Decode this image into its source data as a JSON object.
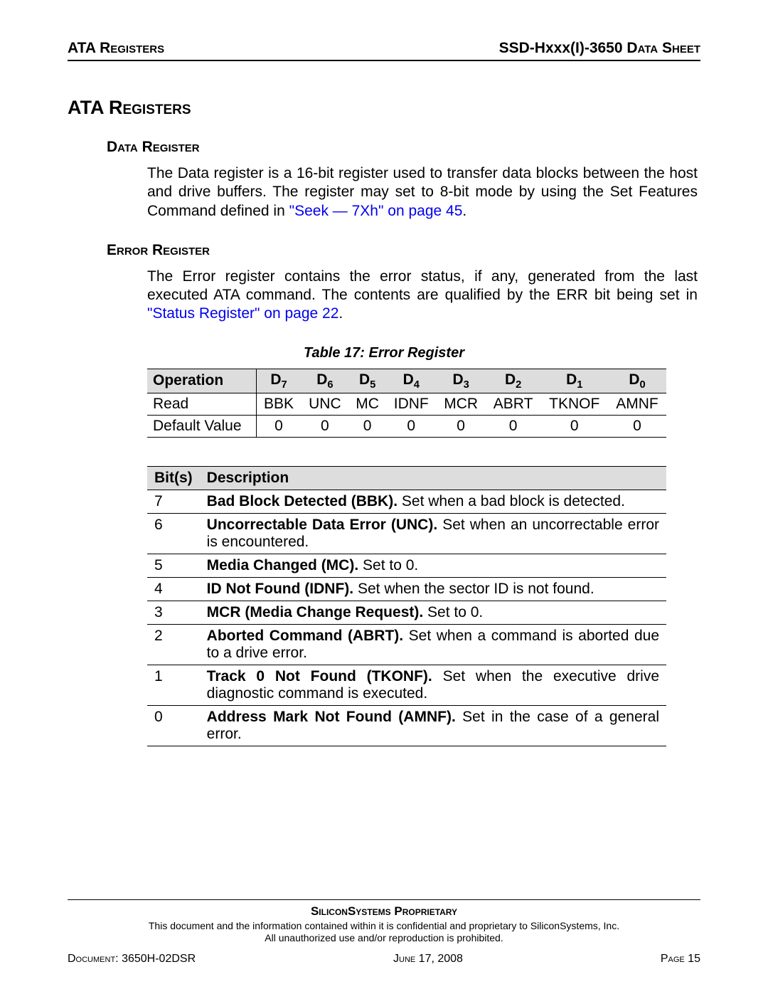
{
  "header": {
    "left": "ATA Registers",
    "right_prefix": "SSD-Hxxx(I)-3650 ",
    "right_suffix": "Data Sheet"
  },
  "title": "ATA Registers",
  "data_register": {
    "heading": "Data Register",
    "text_before_link": "The Data register is a 16-bit register used to transfer data blocks between the host and drive buffers. The register may set to 8-bit mode by using the Set Features Command defined in ",
    "link": "\"Seek — 7Xh\" on page 45",
    "text_after_link": "."
  },
  "error_register": {
    "heading": "Error Register",
    "text_before_link": "The Error register contains the error status, if any, generated from the last executed ATA command. The contents are qualified by the ERR bit being set in ",
    "link": "\"Status Register\" on page 22",
    "text_after_link": "."
  },
  "table17": {
    "caption": "Table 17:  Error Register",
    "headers": {
      "op": "Operation",
      "d": "D"
    },
    "rows": [
      {
        "op": "Read",
        "cells": [
          "BBK",
          "UNC",
          "MC",
          "IDNF",
          "MCR",
          "ABRT",
          "TKNOF",
          "AMNF"
        ]
      },
      {
        "op": "Default Value",
        "cells": [
          "0",
          "0",
          "0",
          "0",
          "0",
          "0",
          "0",
          "0"
        ]
      }
    ]
  },
  "desc_table": {
    "headers": {
      "bits": "Bit(s)",
      "desc": "Description"
    },
    "rows": [
      {
        "bit": "7",
        "bold": "Bad Block Detected (BBK).",
        "rest": " Set when a bad block is detected."
      },
      {
        "bit": "6",
        "bold": "Uncorrectable Data Error (UNC).",
        "rest": " Set when an uncorrectable error is encountered."
      },
      {
        "bit": "5",
        "bold": "Media Changed (MC).",
        "rest": " Set to 0."
      },
      {
        "bit": "4",
        "bold": "ID Not Found (IDNF).",
        "rest": " Set when the sector ID is not found."
      },
      {
        "bit": "3",
        "bold": "MCR (Media Change Request).",
        "rest": " Set to 0."
      },
      {
        "bit": "2",
        "bold": "Aborted Command (ABRT).",
        "rest": " Set when a command is aborted due to a drive error."
      },
      {
        "bit": "1",
        "bold": "Track 0 Not Found (TKONF).",
        "rest": " Set when the executive drive diagnostic command is executed."
      },
      {
        "bit": "0",
        "bold": "Address Mark Not Found (AMNF).",
        "rest": " Set in the case of a general error."
      }
    ]
  },
  "footer": {
    "proprietary": "SiliconSystems Proprietary",
    "conf1": "This document and the information contained within it is confidential and proprietary to SiliconSystems, Inc.",
    "conf2": "All unauthorized use and/or reproduction is prohibited.",
    "doc_label": "Document",
    "doc_value": ": 3650H-02DSR",
    "date": "June 17, 2008",
    "page_label": "Page",
    "page_value": " 15"
  }
}
